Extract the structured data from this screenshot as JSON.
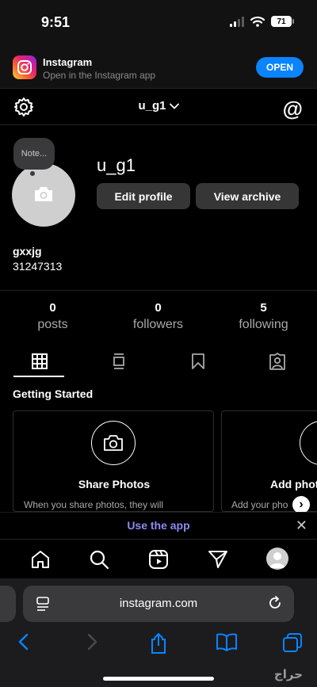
{
  "status_bar": {
    "time": "9:51",
    "battery": "71"
  },
  "banner": {
    "app_name": "Instagram",
    "subtitle": "Open in the Instagram app",
    "open_label": "OPEN"
  },
  "topnav": {
    "username": "u_g1"
  },
  "profile": {
    "note": "Note...",
    "username": "u_g1",
    "edit_label": "Edit profile",
    "archive_label": "View archive",
    "full_name": "gxxjg",
    "bio": "31247313"
  },
  "stats": [
    {
      "count": "0",
      "label": "posts"
    },
    {
      "count": "0",
      "label": "followers"
    },
    {
      "count": "5",
      "label": "following"
    }
  ],
  "getting_started": {
    "title": "Getting Started",
    "cards": [
      {
        "title": "Share Photos",
        "description": "When you share photos, they will"
      },
      {
        "title": "Add phot",
        "description": "Add your pho"
      }
    ]
  },
  "use_app": {
    "label": "Use the app"
  },
  "safari": {
    "url": "instagram.com",
    "watermark": "حراج"
  },
  "colors": {
    "accent": "#0a84ff",
    "use_app": "#8a8bf2",
    "background": "#000000"
  }
}
